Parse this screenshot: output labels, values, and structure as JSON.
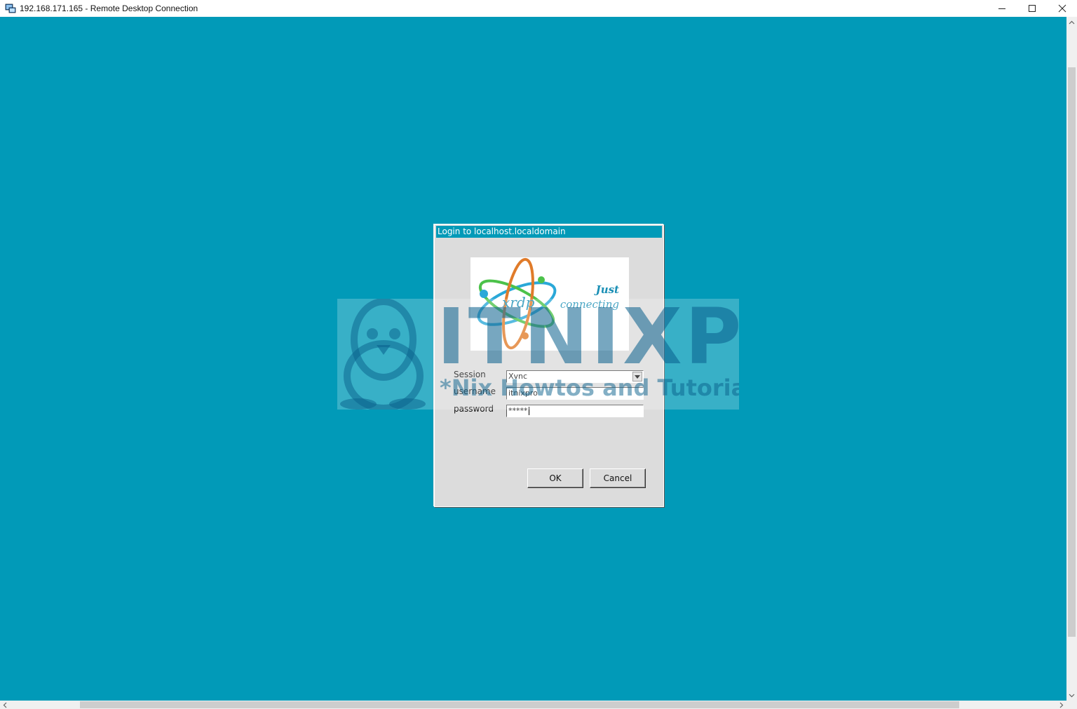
{
  "window": {
    "title": "192.168.171.165 - Remote Desktop Connection",
    "icons": [
      "remote-desktop-icon",
      "minimize-icon",
      "maximize-icon",
      "close-icon"
    ]
  },
  "dialog": {
    "title": "Login to localhost.localdomain",
    "logo": {
      "wordmark": "xrdp",
      "tagline_line1": "Just",
      "tagline_line2": "connecting"
    },
    "session_label": "Session",
    "session_value": "Xvnc",
    "username_label": "username",
    "username_value": "itnixpro",
    "password_label": "password",
    "password_value": "*****",
    "ok_label": "OK",
    "cancel_label": "Cancel"
  },
  "watermark": {
    "brand": "ITNIXPRO",
    "tagline": "*Nix Howtos and Tutorials"
  },
  "colors": {
    "desktop_background": "#019ab8",
    "dialog_background": "#dcdcdc"
  }
}
